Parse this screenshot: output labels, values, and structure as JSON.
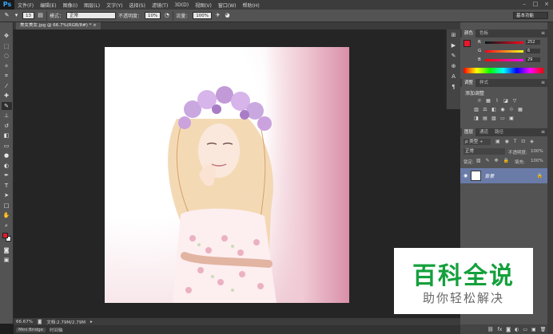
{
  "app": {
    "logo": "Ps"
  },
  "menu": [
    "文件(F)",
    "编辑(E)",
    "图像(I)",
    "图层(L)",
    "文字(Y)",
    "选择(S)",
    "滤镜(T)",
    "3D(D)",
    "视图(V)",
    "窗口(W)",
    "帮助(H)"
  ],
  "window_controls": {
    "minimize": "–",
    "maximize": "□",
    "close": "×"
  },
  "options": {
    "brush_size": "13",
    "mode_label": "模式：",
    "mode_value": "正常",
    "opacity_label": "不透明度：",
    "opacity_value": "10%",
    "flow_label": "流量：",
    "flow_value": "100%",
    "workspace": "基本功能"
  },
  "document": {
    "tab_title": "美女美女.jpg @ 66.7%(RGB/8#) *  ×"
  },
  "status": {
    "zoom": "66.67%",
    "doc_info": "文档:2.79M/2.79M"
  },
  "bottom_tabs": [
    "Mini Bridge",
    "时间轴"
  ],
  "color_panel": {
    "tabs": [
      "颜色",
      "色板"
    ],
    "r_label": "R",
    "r_value": "252",
    "g_label": "G",
    "g_value": "6",
    "b_label": "B",
    "b_value": "29"
  },
  "adjust_panel": {
    "tabs": [
      "调整",
      "样式"
    ],
    "title": "添加调整"
  },
  "layers_panel": {
    "tabs": [
      "图层",
      "通道",
      "路径"
    ],
    "kind_value": "ρ 类型 ÷",
    "blend_value": "正常",
    "opacity_label": "不透明度:",
    "opacity_value": "100%",
    "lock_label": "锁定:",
    "fill_label": "填充:",
    "fill_value": "100%",
    "layer_name": "背景"
  },
  "watermark": {
    "title": "百科全说",
    "subtitle": "助你轻松解决"
  },
  "colors": {
    "accent": "#14a03c",
    "foreground": "#e8182c",
    "layer_selected": "#6a7ba8"
  }
}
